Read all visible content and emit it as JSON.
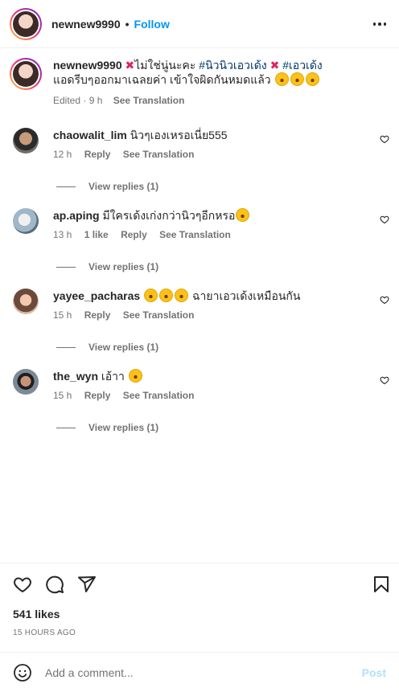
{
  "header": {
    "username": "newnew9990",
    "separator": "•",
    "follow_label": "Follow",
    "more_icon": "more-horizontal-icon"
  },
  "caption": {
    "username": "newnew9990",
    "part1": "ไม่ใช่นู่นะคะ",
    "hashtag1": "#นิวนิวเอวเด้ง",
    "hashtag2": "#เอวเด้ง",
    "line2": "แอดรีบๆออกมาเฉลยค่า เข้าใจผิดกันหมดแล้ว",
    "emoji": "rolling-on-floor-laughing",
    "edited": "Edited · 9 h",
    "see_translation": "See Translation"
  },
  "comments": [
    {
      "username": "chaowalit_lim",
      "text": "นิวๆเองเหรอเนี่ย555",
      "time": "12 h",
      "likes": "",
      "reply": "Reply",
      "see_translation": "See Translation",
      "view_replies": "View replies (1)"
    },
    {
      "username": "ap.aping",
      "text": "มีใครเด้งเก่งกว่านิวๆอีกหรอ",
      "time": "13 h",
      "likes": "1 like",
      "reply": "Reply",
      "see_translation": "See Translation",
      "view_replies": "View replies (1)"
    },
    {
      "username": "yayee_pacharas",
      "text": "ฉายาเอวเด้งเหมือนกัน",
      "time": "15 h",
      "likes": "",
      "reply": "Reply",
      "see_translation": "See Translation",
      "view_replies": "View replies (1)"
    },
    {
      "username": "the_wyn",
      "text": "เอ้าา",
      "time": "15 h",
      "likes": "",
      "reply": "Reply",
      "see_translation": "See Translation",
      "view_replies": "View replies (1)"
    }
  ],
  "footer": {
    "likes": "541 likes",
    "time_ago": "15 HOURS AGO",
    "add_comment_placeholder": "Add a comment...",
    "post_label": "Post"
  },
  "colors": {
    "accent": "#0095f6",
    "hashtag": "#00376b",
    "muted": "#737373",
    "post_disabled": "#b2dffc"
  }
}
